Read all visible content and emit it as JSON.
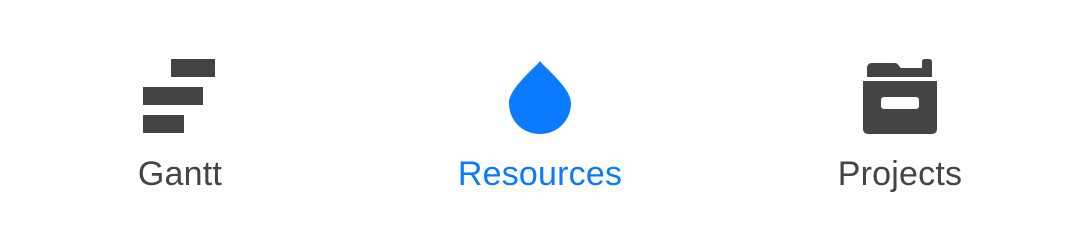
{
  "colors": {
    "active": "#0a7bfe",
    "inactive": "#444444",
    "background": "#ffffff"
  },
  "tabs": [
    {
      "label": "Gantt",
      "icon": "gantt-icon",
      "active": false
    },
    {
      "label": "Resources",
      "icon": "water-drop-icon",
      "active": true
    },
    {
      "label": "Projects",
      "icon": "archive-box-icon",
      "active": false
    }
  ]
}
